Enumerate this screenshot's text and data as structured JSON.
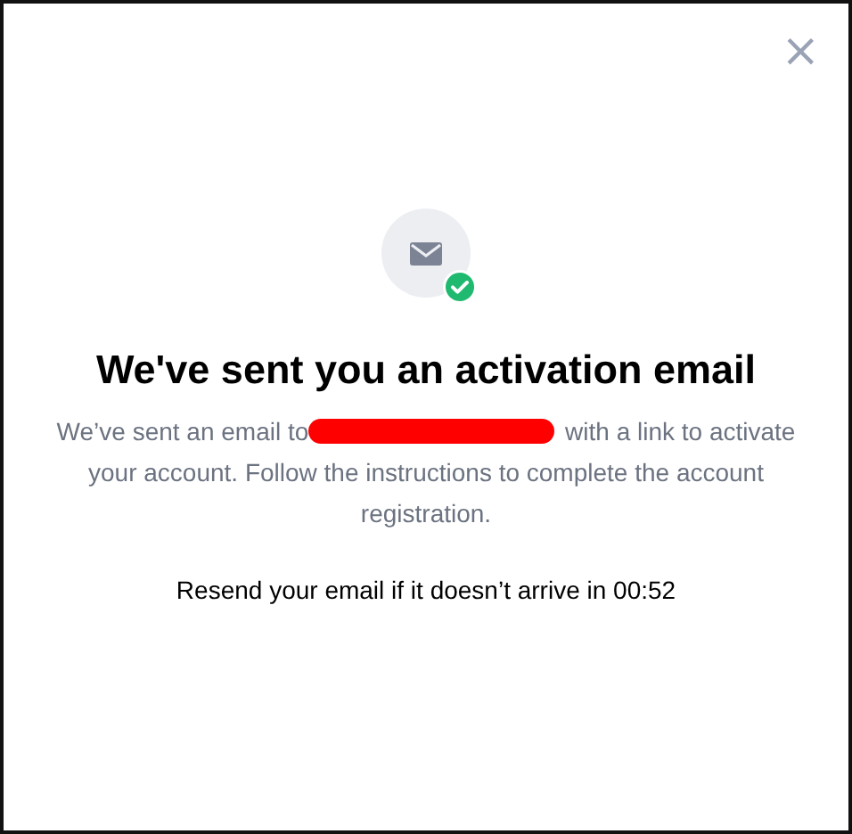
{
  "dialog": {
    "close": "×",
    "title": "We've sent you an activation email",
    "message_start": "We’ve sent an email to",
    "redacted": true,
    "message_end": "with a link to activate your account. Follow the instructions to complete the account registration.",
    "resend": "Resend your email if it doesn’t arrive in 00:52"
  }
}
